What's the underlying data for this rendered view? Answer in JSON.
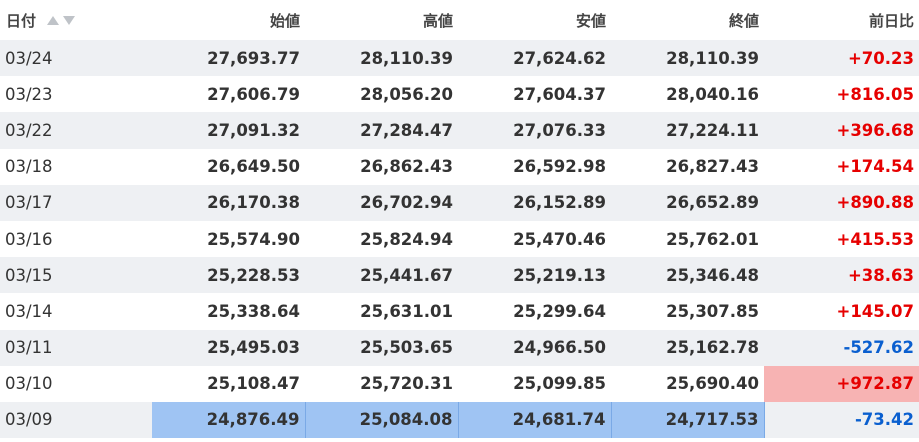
{
  "headers": [
    "日付",
    "始値",
    "高値",
    "安値",
    "終値",
    "前日比"
  ],
  "colors": {
    "up": "#e60000",
    "down": "#0a5fcf",
    "stripe": "#eef0f3",
    "highlight_red": "#f7b3b3",
    "highlight_blue": "#9fc4f3"
  },
  "rows": [
    {
      "date": "03/24",
      "open": "27,693.77",
      "high": "28,110.39",
      "low": "27,624.62",
      "close": "28,110.39",
      "change": "+70.23"
    },
    {
      "date": "03/23",
      "open": "27,606.79",
      "high": "28,056.20",
      "low": "27,604.37",
      "close": "28,040.16",
      "change": "+816.05"
    },
    {
      "date": "03/22",
      "open": "27,091.32",
      "high": "27,284.47",
      "low": "27,076.33",
      "close": "27,224.11",
      "change": "+396.68"
    },
    {
      "date": "03/18",
      "open": "26,649.50",
      "high": "26,862.43",
      "low": "26,592.98",
      "close": "26,827.43",
      "change": "+174.54"
    },
    {
      "date": "03/17",
      "open": "26,170.38",
      "high": "26,702.94",
      "low": "26,152.89",
      "close": "26,652.89",
      "change": "+890.88"
    },
    {
      "date": "03/16",
      "open": "25,574.90",
      "high": "25,824.94",
      "low": "25,470.46",
      "close": "25,762.01",
      "change": "+415.53"
    },
    {
      "date": "03/15",
      "open": "25,228.53",
      "high": "25,441.67",
      "low": "25,219.13",
      "close": "25,346.48",
      "change": "+38.63"
    },
    {
      "date": "03/14",
      "open": "25,338.64",
      "high": "25,631.01",
      "low": "25,299.64",
      "close": "25,307.85",
      "change": "+145.07"
    },
    {
      "date": "03/11",
      "open": "25,495.03",
      "high": "25,503.65",
      "low": "24,966.50",
      "close": "25,162.78",
      "change": "-527.62"
    },
    {
      "date": "03/10",
      "open": "25,108.47",
      "high": "25,720.31",
      "low": "25,099.85",
      "close": "25,690.40",
      "change": "+972.87"
    },
    {
      "date": "03/09",
      "open": "24,876.49",
      "high": "25,084.08",
      "low": "24,681.74",
      "close": "24,717.53",
      "change": "-73.42"
    }
  ]
}
